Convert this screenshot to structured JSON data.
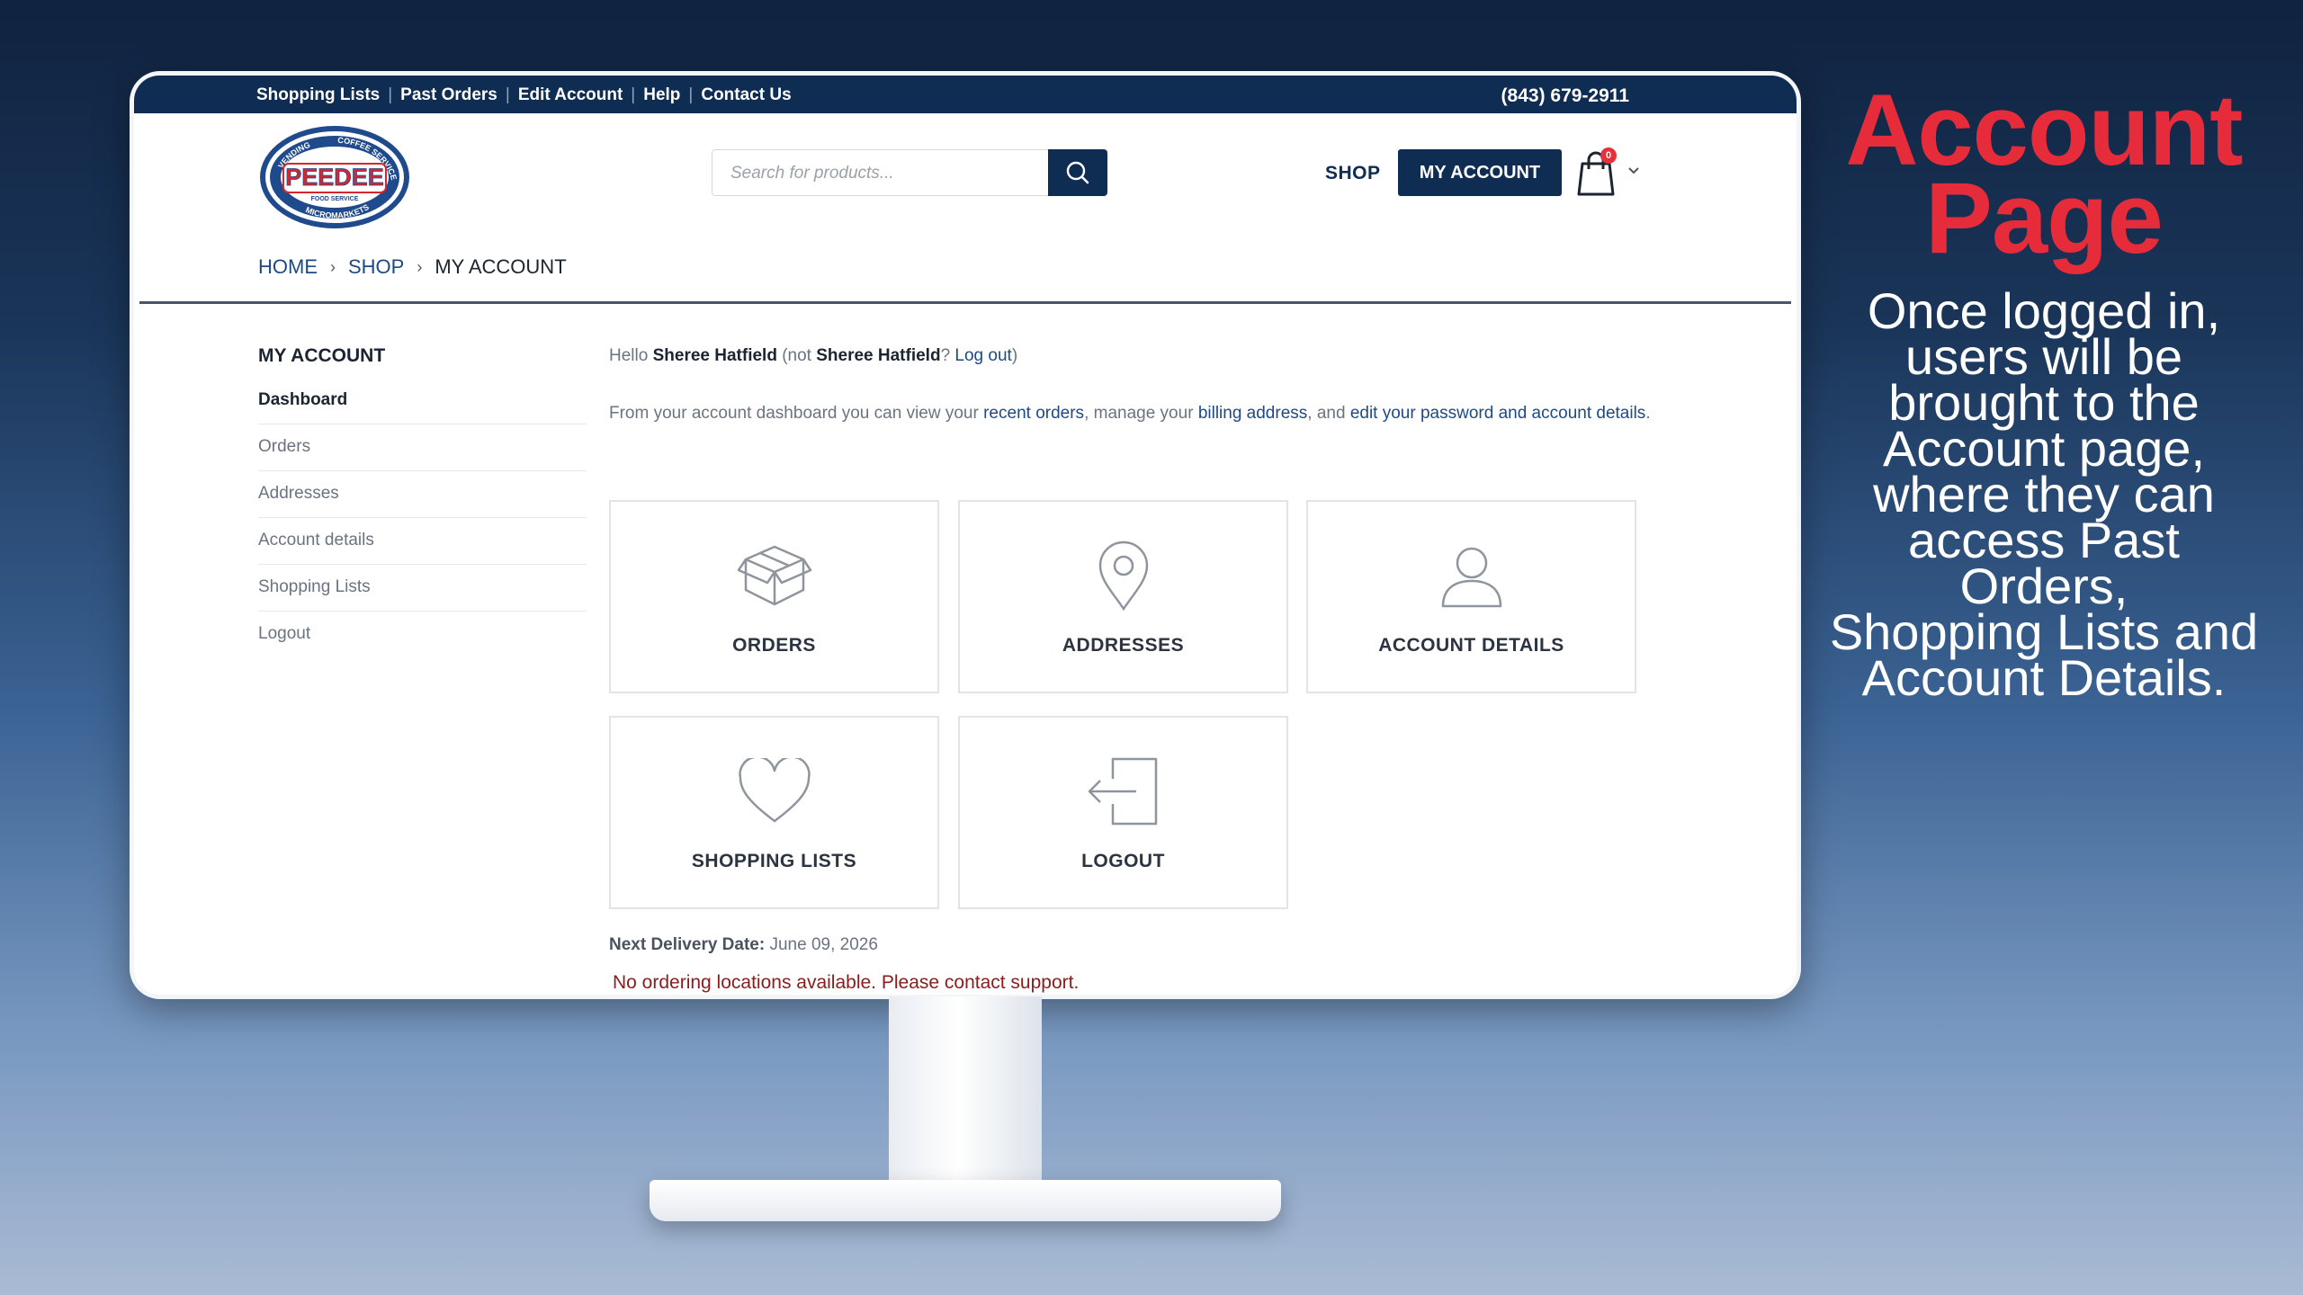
{
  "topbar": {
    "links": [
      "Shopping Lists",
      "Past Orders",
      "Edit Account",
      "Help",
      "Contact Us"
    ],
    "phone": "(843) 679-2911"
  },
  "logo": {
    "main": "PEEDEE",
    "arc_top": "COFFEE SERVICE",
    "arc_left": "VENDING",
    "arc_bottom": "MICROMARKETS",
    "small": "FOOD SERVICE"
  },
  "search": {
    "placeholder": "Search for products..."
  },
  "header": {
    "shop_label": "SHOP",
    "my_account_label": "MY ACCOUNT",
    "cart_count": "0"
  },
  "breadcrumb": {
    "home": "HOME",
    "shop": "SHOP",
    "current": "MY ACCOUNT"
  },
  "sidebar": {
    "title": "MY ACCOUNT",
    "items": [
      {
        "label": "Dashboard",
        "active": true
      },
      {
        "label": "Orders"
      },
      {
        "label": "Addresses"
      },
      {
        "label": "Account details"
      },
      {
        "label": "Shopping Lists"
      },
      {
        "label": "Logout"
      }
    ]
  },
  "main": {
    "hello_prefix": "Hello",
    "user_name": "Sheree Hatfield",
    "not_text": "(not",
    "not_name": "Sheree Hatfield",
    "question": "?",
    "logout_link": "Log out",
    "close_paren": ")",
    "intro_1": "From your account dashboard you can view your",
    "intro_link_orders": "recent orders",
    "intro_2": ", manage your",
    "intro_link_billing": "billing address",
    "intro_3": ", and",
    "intro_link_edit": "edit your password and account details",
    "intro_4": ".",
    "tiles": [
      {
        "label": "ORDERS",
        "icon": "box-icon"
      },
      {
        "label": "ADDRESSES",
        "icon": "map-pin-icon"
      },
      {
        "label": "ACCOUNT DETAILS",
        "icon": "user-icon"
      },
      {
        "label": "SHOPPING LISTS",
        "icon": "heart-icon"
      },
      {
        "label": "LOGOUT",
        "icon": "logout-icon"
      }
    ],
    "delivery_label": "Next Delivery Date:",
    "delivery_value": "June 09, 2026",
    "warning": "No ordering locations available. Please contact support."
  },
  "promo": {
    "title_line1": "Account",
    "title_line2": "Page",
    "body_lines": [
      "Once logged in,",
      "users will be",
      "brought to the",
      "Account page,",
      "where they can",
      "access Past Orders,",
      "Shopping Lists and",
      "Account Details."
    ]
  },
  "colors": {
    "navy": "#0f2c52",
    "link_blue": "#1d4a85",
    "promo_red": "#e62c3a",
    "warning_red": "#8a1c1c",
    "badge_red": "#e8303a"
  }
}
